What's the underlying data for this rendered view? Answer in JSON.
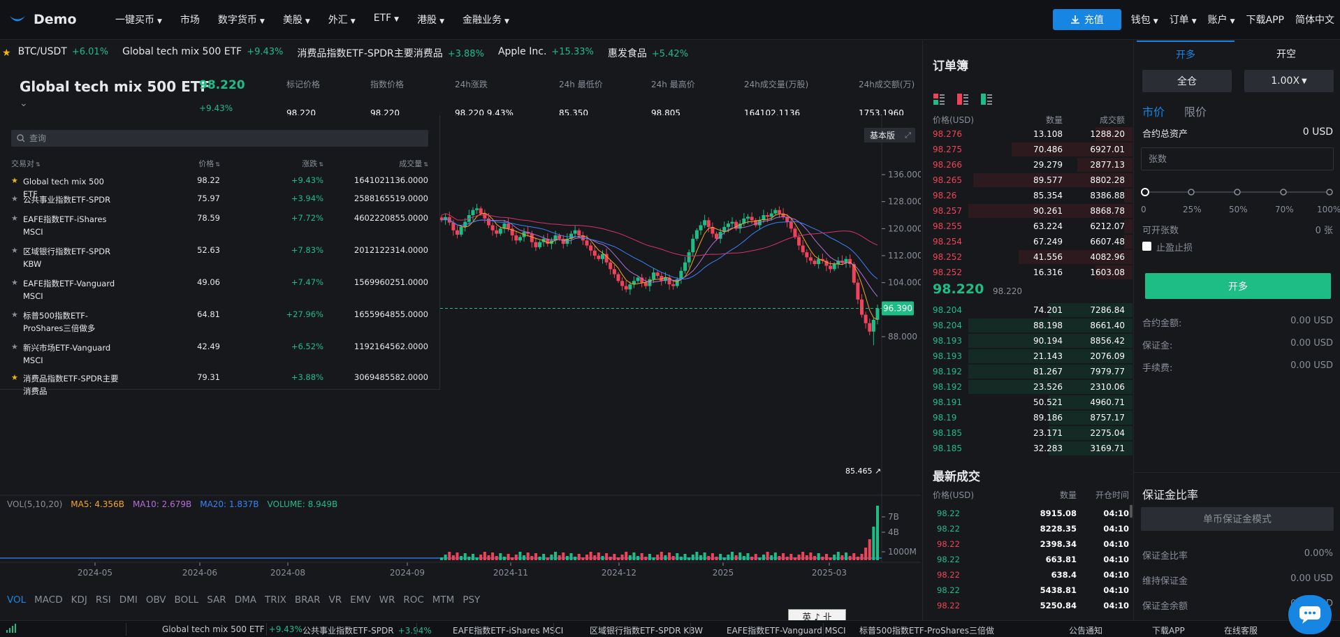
{
  "nav": {
    "brand": "Demo",
    "items": [
      {
        "label": "一键买币",
        "caret": true
      },
      {
        "label": "市场",
        "caret": false
      },
      {
        "label": "数字货币",
        "caret": true
      },
      {
        "label": "美股",
        "caret": true
      },
      {
        "label": "外汇",
        "caret": true
      },
      {
        "label": "ETF",
        "caret": true
      },
      {
        "label": "港股",
        "caret": true
      },
      {
        "label": "金融业务",
        "caret": true
      }
    ],
    "recharge": "充值",
    "right": [
      "钱包",
      "订单",
      "账户",
      "下载APP",
      "简体中文"
    ]
  },
  "ticker": [
    {
      "name": "BTC/USDT",
      "change": "+6.01%"
    },
    {
      "name": "Global tech mix 500 ETF",
      "change": "+9.43%"
    },
    {
      "name": "消费品指数ETF-SPDR主要消费品",
      "change": "+3.88%"
    },
    {
      "name": "Apple Inc.",
      "change": "+15.33%"
    },
    {
      "name": "惠发食品",
      "change": "+5.42%"
    }
  ],
  "pair": {
    "name": "Global tech mix 500 ETF",
    "price": "98.220",
    "change": "+9.43%",
    "stats": [
      {
        "label": "标记价格",
        "value": "98.220"
      },
      {
        "label": "指数价格",
        "value": "98.220"
      },
      {
        "label": "24h涨跌",
        "value": "98.220  9.43%"
      },
      {
        "label": "24h 最低价",
        "value": "85.350"
      },
      {
        "label": "24h 最高价",
        "value": "98.805"
      },
      {
        "label": "24h成交量(万股)",
        "value": "164102.1136"
      },
      {
        "label": "24h成交额(万)",
        "value": "1753.1960"
      }
    ]
  },
  "dropdown": {
    "search_placeholder": "查询",
    "headers": [
      "交易对",
      "价格",
      "涨跌",
      "成交量"
    ],
    "rows": [
      {
        "name": "Global tech mix 500 ETF",
        "price": "98.22",
        "change": "+9.43%",
        "volume": "1641021136.0000",
        "fav": true
      },
      {
        "name": "公共事业指数ETF-SPDR",
        "price": "75.97",
        "change": "+3.94%",
        "volume": "2588165519.0000",
        "fav": false
      },
      {
        "name": "EAFE指数ETF-iShares MSCI",
        "price": "78.59",
        "change": "+7.72%",
        "volume": "4602220855.0000",
        "fav": false
      },
      {
        "name": "区域银行指数ETF-SPDR KBW",
        "price": "52.63",
        "change": "+7.83%",
        "volume": "2012122314.0000",
        "fav": false
      },
      {
        "name": "EAFE指数ETF-Vanguard MSCI",
        "price": "49.06",
        "change": "+7.47%",
        "volume": "1569960251.0000",
        "fav": false
      },
      {
        "name": "标普500指数ETF-ProShares三倍做多",
        "price": "64.81",
        "change": "+27.96%",
        "volume": "1655964855.0000",
        "fav": false
      },
      {
        "name": "新兴市场ETF-Vanguard MSCI",
        "price": "42.49",
        "change": "+6.52%",
        "volume": "1192164562.0000",
        "fav": false
      },
      {
        "name": "消费品指数ETF-SPDR主要消费品",
        "price": "79.31",
        "change": "+3.88%",
        "volume": "3069485582.0000",
        "fav": true
      }
    ]
  },
  "chart": {
    "basic_label": "基本版",
    "last_tag": "96.390",
    "low_label": "85.465",
    "vol_legend": [
      {
        "text": "VOL(5,10,20)",
        "color": "#8a8f98"
      },
      {
        "text": "MA5: 4.356B",
        "color": "#f5a623"
      },
      {
        "text": "MA10: 2.679B",
        "color": "#b36fd6"
      },
      {
        "text": "MA20: 1.837B",
        "color": "#3b82f6"
      },
      {
        "text": "VOLUME: 8.949B",
        "color": "#1ebd85"
      }
    ],
    "indicators": [
      "VOL",
      "MACD",
      "KDJ",
      "RSI",
      "DMI",
      "OBV",
      "BOLL",
      "SAR",
      "DMA",
      "TRIX",
      "BRAR",
      "VR",
      "EMV",
      "WR",
      "ROC",
      "MTM",
      "PSY"
    ],
    "ime": "英 ♪ 卝"
  },
  "chart_data": {
    "type": "candlestick",
    "y_ticks": [
      136,
      128,
      120,
      112,
      104,
      96,
      88
    ],
    "y_tick_labels": [
      "136.000",
      "128.000",
      "120.000",
      "112.000",
      "104.000",
      "96.390",
      "88.000"
    ],
    "vol_ticks": [
      "7B",
      "4B",
      "1000M"
    ],
    "x_labels": [
      "2024-05",
      "2024-06",
      "2024-08",
      "2024-09",
      "2024-11",
      "2024-12",
      "2025",
      "2025-03"
    ],
    "last": 96.39,
    "low": 85.465,
    "visible_closes": [
      122.5,
      123.4,
      121.8,
      119.5,
      118.2,
      120.5,
      122.0,
      124.0,
      125.5,
      126.0,
      124.5,
      123.0,
      121.0,
      119.5,
      118.5,
      120.0,
      121.5,
      120.0,
      118.0,
      116.5,
      117.5,
      119.0,
      118.5,
      116.0,
      114.5,
      116.0,
      117.0,
      115.5,
      116.5,
      118.0,
      117.0,
      115.5,
      117.0,
      118.5,
      119.5,
      118.0,
      116.5,
      115.0,
      113.5,
      112.0,
      111.0,
      112.5,
      110.0,
      108.0,
      106.5,
      104.5,
      103.0,
      102.0,
      103.5,
      104.5,
      105.5,
      104.0,
      103.0,
      105.0,
      107.0,
      106.0,
      104.5,
      105.5,
      103.5,
      103.0,
      105.0,
      107.5,
      110.0,
      113.0,
      117.0,
      119.5,
      121.0,
      122.5,
      120.5,
      118.5,
      117.0,
      119.0,
      120.5,
      121.5,
      122.0,
      120.0,
      121.5,
      123.0,
      123.5,
      122.5,
      121.0,
      122.5,
      124.0,
      123.5,
      124.5,
      125.5,
      124.5,
      123.5,
      122.0,
      120.0,
      117.5,
      115.0,
      113.0,
      111.5,
      110.5,
      109.5,
      111.0,
      110.5,
      109.0,
      108.0,
      109.5,
      110.5,
      110.0,
      111.0,
      109.5,
      104.0,
      99.0,
      94.5,
      92.0,
      89.5,
      93.0,
      96.39
    ]
  },
  "orderbook": {
    "title": "订单簿",
    "headers": [
      "价格(USD)",
      "数量",
      "成交额"
    ],
    "asks": [
      {
        "price": "98.276",
        "qty": "13.108",
        "total": "1288.20",
        "depth": 0.22
      },
      {
        "price": "98.275",
        "qty": "70.486",
        "total": "6927.01",
        "depth": 0.72
      },
      {
        "price": "98.266",
        "qty": "29.279",
        "total": "2877.13",
        "depth": 0.33
      },
      {
        "price": "98.265",
        "qty": "89.577",
        "total": "8802.28",
        "depth": 0.95
      },
      {
        "price": "98.26",
        "qty": "85.354",
        "total": "8386.88",
        "depth": 0.05
      },
      {
        "price": "98.257",
        "qty": "90.261",
        "total": "8868.78",
        "depth": 0.98
      },
      {
        "price": "98.255",
        "qty": "63.224",
        "total": "6212.07",
        "depth": 0.05
      },
      {
        "price": "98.254",
        "qty": "67.249",
        "total": "6607.48",
        "depth": 0.05
      },
      {
        "price": "98.252",
        "qty": "41.556",
        "total": "4082.96",
        "depth": 0.68
      },
      {
        "price": "98.252",
        "qty": "16.316",
        "total": "1603.08",
        "depth": 0.22
      }
    ],
    "mid": "98.220",
    "mid_sub": "98.220",
    "bids": [
      {
        "price": "98.204",
        "qty": "74.201",
        "total": "7286.84",
        "depth": 0.5
      },
      {
        "price": "98.204",
        "qty": "88.198",
        "total": "8661.40",
        "depth": 0.98
      },
      {
        "price": "98.193",
        "qty": "90.194",
        "total": "8856.42",
        "depth": 0.98
      },
      {
        "price": "98.193",
        "qty": "21.143",
        "total": "2076.09",
        "depth": 0.98
      },
      {
        "price": "98.192",
        "qty": "81.267",
        "total": "7979.77",
        "depth": 0.98
      },
      {
        "price": "98.192",
        "qty": "23.526",
        "total": "2310.06",
        "depth": 0.98
      },
      {
        "price": "98.191",
        "qty": "50.521",
        "total": "4960.71",
        "depth": 0.5
      },
      {
        "price": "98.19",
        "qty": "89.186",
        "total": "8757.17",
        "depth": 0.5
      },
      {
        "price": "98.185",
        "qty": "23.171",
        "total": "2275.04",
        "depth": 0.5
      },
      {
        "price": "98.185",
        "qty": "32.283",
        "total": "3169.71",
        "depth": 0.5
      }
    ]
  },
  "trades": {
    "title": "最新成交",
    "headers": [
      "价格(USD)",
      "数量",
      "开仓时间"
    ],
    "rows": [
      {
        "price": "98.22",
        "qty": "8915.08",
        "time": "04:10",
        "side": "up"
      },
      {
        "price": "98.22",
        "qty": "8228.35",
        "time": "04:10",
        "side": "up"
      },
      {
        "price": "98.22",
        "qty": "2398.34",
        "time": "04:10",
        "side": "dn"
      },
      {
        "price": "98.22",
        "qty": "663.81",
        "time": "04:10",
        "side": "up"
      },
      {
        "price": "98.22",
        "qty": "638.4",
        "time": "04:10",
        "side": "dn"
      },
      {
        "price": "98.22",
        "qty": "5438.81",
        "time": "04:10",
        "side": "up"
      },
      {
        "price": "98.22",
        "qty": "5250.84",
        "time": "04:10",
        "side": "dn"
      }
    ]
  },
  "trade": {
    "tab_long": "开多",
    "tab_short": "开空",
    "margin": "全仓",
    "leverage": "1.00X",
    "market": "市价",
    "limit": "限价",
    "total_label": "合约总资产",
    "total_value": "0 USD",
    "qty_placeholder": "张数",
    "pcts": [
      "0",
      "25%",
      "50%",
      "70%",
      "100%"
    ],
    "avail_label": "可开张数",
    "avail_value": "0 张",
    "tpsl": "止盈止损",
    "open_btn": "开多",
    "fees": [
      {
        "label": "合约金额:",
        "value": "0.00 USD"
      },
      {
        "label": "保证金:",
        "value": "0.00 USD"
      },
      {
        "label": "手续费:",
        "value": "0.00 USD"
      }
    ],
    "margin_title": "保证金比率",
    "margin_mode": "单币保证金模式",
    "margin_rows": [
      {
        "label": "保证金比率",
        "value": "0.00%"
      },
      {
        "label": "维持保证金",
        "value": "0.00 USD"
      },
      {
        "label": "保证金余额",
        "value": "0.00 USD"
      }
    ]
  },
  "bottom": {
    "items": [
      {
        "name": "Global tech mix 500 ETF",
        "change": "+9.43%"
      },
      {
        "name": "公共事业指数ETF-SPDR",
        "change": "+3.94%"
      },
      {
        "name": "EAFE指数ETF-iShares MSCI",
        "change": ""
      },
      {
        "name": "区域银行指数ETF-SPDR KBW",
        "change": ""
      },
      {
        "name": "EAFE指数ETF-Vanguard MSCI",
        "change": ""
      },
      {
        "name": "标普500指数ETF-ProShares三倍做",
        "change": ""
      }
    ],
    "notice": "公告通知",
    "download": "下载APP",
    "service": "在线客服"
  },
  "colors": {
    "up": "#1ebd85",
    "down": "#f0435a",
    "accent": "#1786e3"
  }
}
